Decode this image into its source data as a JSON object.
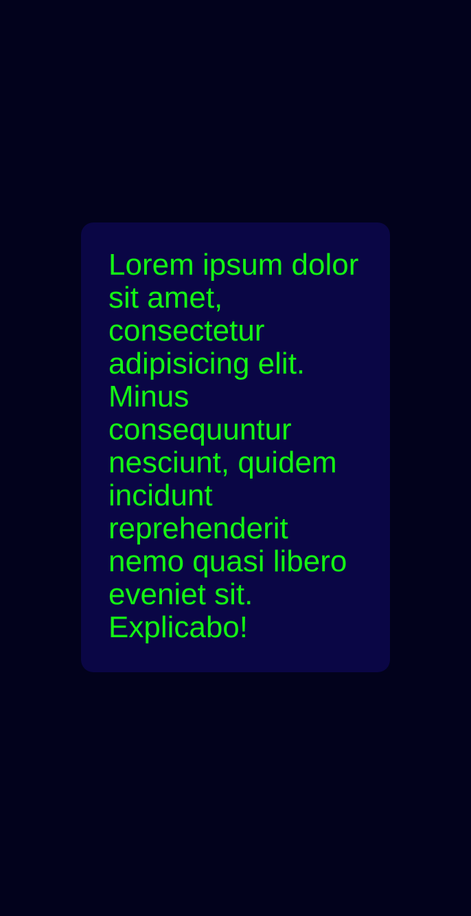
{
  "card": {
    "text": "Lorem ipsum dolor sit amet, consectetur adipisicing elit. Minus consequuntur nesciunt, quidem incidunt reprehenderit nemo quasi libero eveniet sit. Explicabo!"
  },
  "colors": {
    "background": "#02021c",
    "card_background": "#0a0645",
    "text": "#14f514"
  }
}
